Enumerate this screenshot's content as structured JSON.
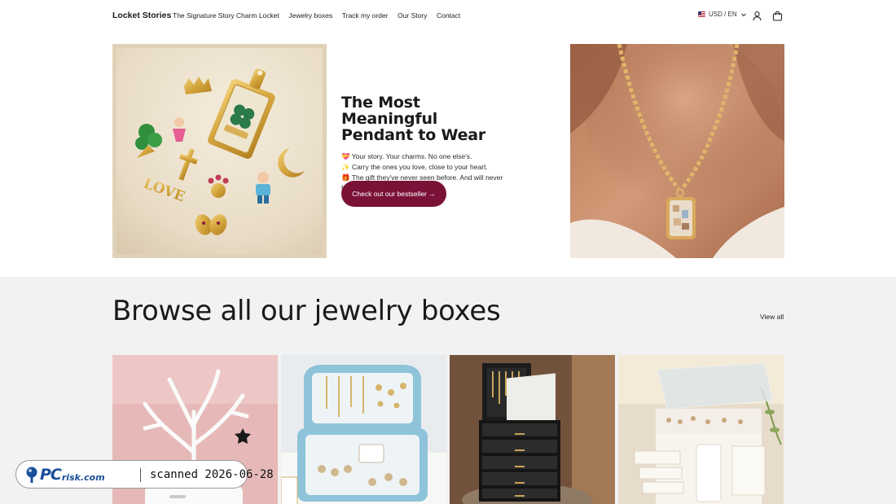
{
  "header": {
    "brand": "Locket Stories",
    "nav": [
      {
        "label": "The Signature Story Charm Locket"
      },
      {
        "label": "Jewelry boxes"
      },
      {
        "label": "Track my order"
      },
      {
        "label": "Our Story"
      },
      {
        "label": "Contact"
      }
    ],
    "locale": "USD / EN",
    "icons": [
      "flag-us-icon",
      "chevron-down-icon",
      "account-icon",
      "cart-icon"
    ]
  },
  "hero": {
    "title": "The Most Meaningful Pendant to Wear",
    "body_lines": [
      "💝 Your story. Your charms. No one else's.",
      "✨ Carry the ones you love, close to your heart.",
      "🎁 The gift they've never seen before. And will never take off."
    ],
    "cta_label": "Check out our bestseller →"
  },
  "browse": {
    "title": "Browse all our jewelry boxes",
    "view_all": "View all"
  },
  "watermark": {
    "logo_pc": "PC",
    "logo_risk": "risk.com",
    "text": "scanned 2026-06-28"
  },
  "colors": {
    "cta": "#7a1238",
    "section_bg": "#f2f2f2",
    "watermark_blue": "#1a4f9c"
  }
}
